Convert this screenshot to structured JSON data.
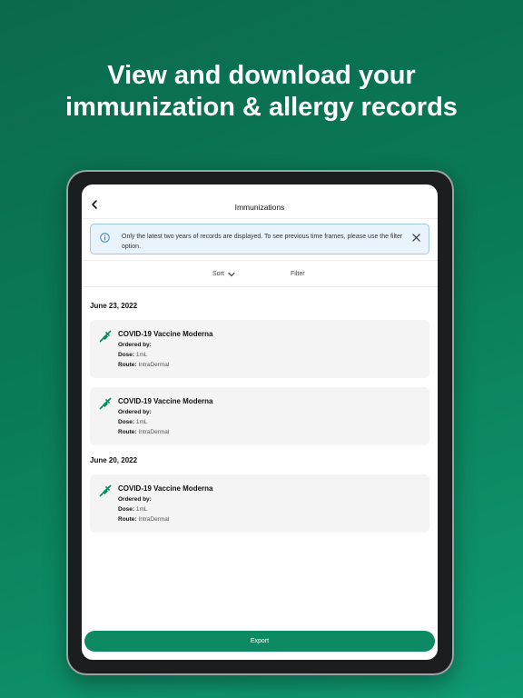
{
  "headline": {
    "line1": "View and download your",
    "line2": "immunization & allergy records"
  },
  "nav": {
    "title": "Immunizations",
    "back_icon": "chevron-left-icon"
  },
  "banner": {
    "text": "Only the latest two years of records are displayed. To see previous time frames, please use the filter option.",
    "info_icon": "info-icon",
    "close_icon": "close-icon"
  },
  "toolbar": {
    "sort_label": "Sort",
    "filter_label": "Filter"
  },
  "groups": [
    {
      "date": "June 23, 2022",
      "records": [
        {
          "title": "COVID-19 Vaccine Moderna",
          "ordered_by_label": "Ordered by:",
          "ordered_by": "",
          "dose_label": "Dose:",
          "dose": "1mL",
          "route_label": "Route:",
          "route": "IntraDermal"
        },
        {
          "title": "COVID-19 Vaccine Moderna",
          "ordered_by_label": "Ordered by:",
          "ordered_by": "",
          "dose_label": "Dose:",
          "dose": "1mL",
          "route_label": "Route:",
          "route": "IntraDermal"
        }
      ]
    },
    {
      "date": "June 20, 2022",
      "records": [
        {
          "title": "COVID-19 Vaccine Moderna",
          "ordered_by_label": "Ordered by:",
          "ordered_by": "",
          "dose_label": "Dose:",
          "dose": "1mL",
          "route_label": "Route:",
          "route": "IntraDermal"
        }
      ]
    }
  ],
  "export_label": "Export",
  "colors": {
    "brand_green": "#0d8a63",
    "banner_bg": "#e9f3fb",
    "banner_border": "#9ec6e6"
  }
}
